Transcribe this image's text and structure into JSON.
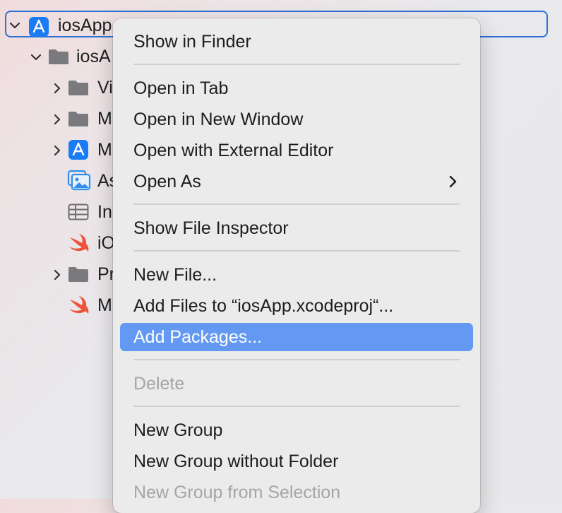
{
  "navigator": {
    "root": {
      "label": "iosApp",
      "icon": "app-project-icon"
    },
    "group": {
      "label": "iosA",
      "icon": "folder-icon"
    },
    "items": [
      {
        "label": "Vi",
        "icon": "folder-icon",
        "expandable": true
      },
      {
        "label": "M",
        "icon": "folder-icon",
        "expandable": true
      },
      {
        "label": "M",
        "icon": "app-target-icon",
        "expandable": true
      },
      {
        "label": "As",
        "icon": "asset-catalog-icon",
        "expandable": false
      },
      {
        "label": "In",
        "icon": "plist-table-icon",
        "expandable": false
      },
      {
        "label": "iO",
        "icon": "swift-file-icon",
        "expandable": false
      },
      {
        "label": "Pr",
        "icon": "folder-icon",
        "expandable": true
      },
      {
        "label": "M",
        "icon": "swift-file-icon",
        "expandable": false
      }
    ]
  },
  "context_menu": {
    "items": {
      "show_in_finder": "Show in Finder",
      "open_in_tab": "Open in Tab",
      "open_in_new_window": "Open in New Window",
      "open_with_external_editor": "Open with External Editor",
      "open_as": "Open As",
      "show_file_inspector": "Show File Inspector",
      "new_file": "New File...",
      "add_files": "Add Files to “iosApp.xcodeproj“...",
      "add_packages": "Add Packages...",
      "delete": "Delete",
      "new_group": "New Group",
      "new_group_without_folder": "New Group without Folder",
      "new_group_from_selection": "New Group from Selection"
    },
    "highlighted": "add_packages",
    "disabled": [
      "delete",
      "new_group_from_selection"
    ]
  },
  "colors": {
    "selection_border": "#2f6fd6",
    "highlight": "#6399f3",
    "swift_orange": "#f05138",
    "app_icon_blue": "#1a7cf5",
    "folder_gray": "#7a7a7e"
  }
}
